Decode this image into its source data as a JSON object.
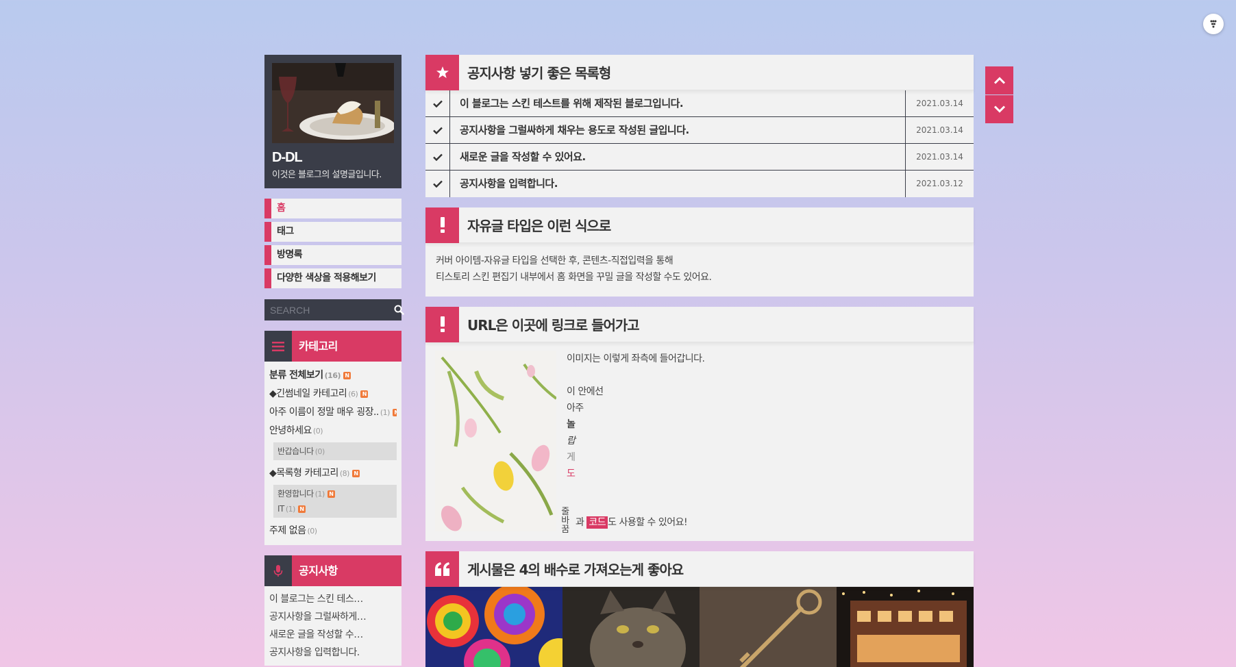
{
  "profile": {
    "name": "D-DL",
    "desc": "이것은 블로그의 설명글입니다."
  },
  "nav": {
    "items": [
      {
        "label": "홈"
      },
      {
        "label": "태그"
      },
      {
        "label": "방명록"
      },
      {
        "label": "다양한 색상을 적용해보기"
      }
    ]
  },
  "search": {
    "placeholder": "SEARCH"
  },
  "category": {
    "title": "카테고리",
    "all_label": "분류 전체보기",
    "all_count": "(16)",
    "items": [
      {
        "label": "◆긴썸네일 카테고리",
        "count": "(6)"
      },
      {
        "label": "아주 이름이 정말 매우 굉장..",
        "count": "(1)"
      },
      {
        "label": "안녕하세요",
        "count": "(0)"
      },
      {
        "label": "◆목록형 카테고리",
        "count": "(8)"
      },
      {
        "label": "주제 없음",
        "count": "(0)"
      }
    ],
    "sub_hello": [
      {
        "label": "반갑습니다",
        "count": "(0)"
      }
    ],
    "sub_list": [
      {
        "label": "환영합니다",
        "count": "(1)"
      },
      {
        "label": "IT",
        "count": "(1)"
      }
    ],
    "new_badge": "N"
  },
  "notice_widget": {
    "title": "공지사항",
    "items": [
      {
        "label": "이 블로그는 스킨 테스…"
      },
      {
        "label": "공지사항을 그럴싸하게…"
      },
      {
        "label": "새로운 글을 작성할 수…"
      },
      {
        "label": "공지사항을 입력합니다."
      }
    ]
  },
  "main": {
    "notice_panel": {
      "title": "공지사항 넣기 좋은 목록형",
      "rows": [
        {
          "text": "이 블로그는 스킨 테스트를 위해 제작된 블로그입니다.",
          "date": "2021.03.14"
        },
        {
          "text": "공지사항을 그럴싸하게 채우는 용도로 작성된 글입니다.",
          "date": "2021.03.14"
        },
        {
          "text": "새로운 글을 작성할 수 있어요.",
          "date": "2021.03.14"
        },
        {
          "text": "공지사항을 입력합니다.",
          "date": "2021.03.12"
        }
      ]
    },
    "free_panel": {
      "title": "자유글 타입은 이런 식으로",
      "line1": "커버 아이템-자유글 타입을 선택한 후, 콘텐츠-직접입력을 통해",
      "line2": "티스토리 스킨 편집기 내부에서 홈 화면을 꾸밀 글을 작성할 수도 있어요."
    },
    "url_panel": {
      "title": "URL은 이곳에 링크로 들어가고",
      "line1": "이미지는 이렇게 좌측에 들어갑니다.",
      "line2": "이 안에선",
      "line3": "아주",
      "line4": "놀",
      "line5": "랍",
      "line6": "게",
      "line7": "도",
      "vertical": "줄바꿈",
      "code_pre": "과",
      "code": "코드",
      "code_post": "도 사용할 수 있어요!"
    },
    "gallery_panel": {
      "title": "게시물은 4의 배수로 가져오는게 좋아요"
    }
  },
  "colors": {
    "accent": "#d93a64",
    "dark": "#3a3d48",
    "panel": "#f2f2f2"
  }
}
